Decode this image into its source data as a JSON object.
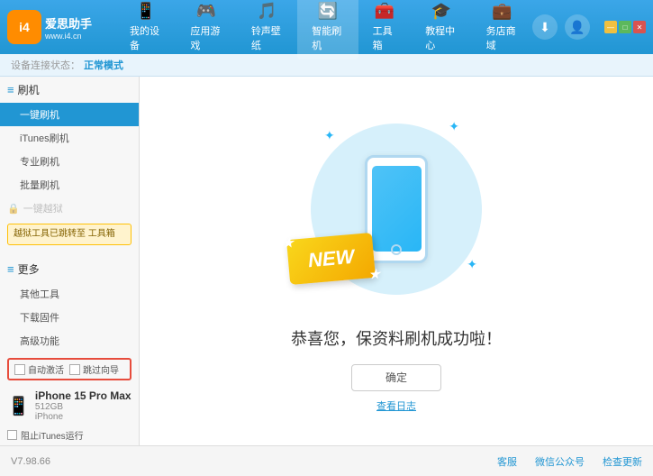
{
  "app": {
    "logo": "i4",
    "brand": "爱思助手",
    "site": "www.i4.cn"
  },
  "nav": {
    "items": [
      {
        "id": "my-device",
        "label": "我的设备",
        "icon": "📱"
      },
      {
        "id": "apps-games",
        "label": "应用游戏",
        "icon": "👤"
      },
      {
        "id": "ringtones",
        "label": "铃声壁纸",
        "icon": "🎵"
      },
      {
        "id": "smart-flash",
        "label": "智能刷机",
        "icon": "🔄",
        "active": true
      },
      {
        "id": "toolbox",
        "label": "工具箱",
        "icon": "🧰"
      },
      {
        "id": "tutorials",
        "label": "教程中心",
        "icon": "🎓"
      },
      {
        "id": "service",
        "label": "务店商域",
        "icon": "💼"
      }
    ]
  },
  "header_right": {
    "download_icon": "⬇",
    "user_icon": "👤"
  },
  "window_controls": {
    "minimize": "—",
    "maximize": "□",
    "close": "✕"
  },
  "status_bar": {
    "label": "设备连接状态：",
    "value": "正常模式"
  },
  "sidebar": {
    "flash_section_label": "刷机",
    "items": [
      {
        "id": "one-click-flash",
        "label": "一键刷机",
        "active": true
      },
      {
        "id": "itunes-flash",
        "label": "iTunes刷机",
        "active": false
      },
      {
        "id": "pro-flash",
        "label": "专业刷机",
        "active": false
      },
      {
        "id": "batch-flash",
        "label": "批量刷机",
        "active": false
      }
    ],
    "disabled_section_label": "一键越狱",
    "warning_text": "越狱工具已跳转至\n工具箱",
    "more_section_label": "更多",
    "more_items": [
      {
        "id": "other-tools",
        "label": "其他工具"
      },
      {
        "id": "download-firmware",
        "label": "下载固件"
      },
      {
        "id": "advanced",
        "label": "高级功能"
      }
    ],
    "auto_activate_label": "自动激活",
    "guide_restore_label": "跳过向导",
    "device": {
      "name": "iPhone 15 Pro Max",
      "storage": "512GB",
      "type": "iPhone"
    },
    "itunes_label": "阻止iTunes运行"
  },
  "content": {
    "new_badge": "NEW",
    "success_title": "恭喜您，保资料刷机成功啦！",
    "confirm_label": "确定",
    "log_label": "查看日志"
  },
  "footer": {
    "version": "V7.98.66",
    "links": [
      "客服",
      "微信公众号",
      "检查更新"
    ]
  }
}
